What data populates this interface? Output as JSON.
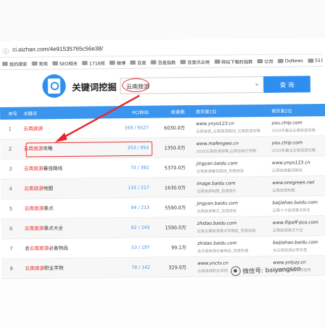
{
  "browser": {
    "url": "ci.aizhan.com/4e91535765c56e38/",
    "bookmarks": [
      "我的搜索",
      "常用",
      "SEO相关",
      "1718视",
      "微博",
      "百度",
      "百度指数",
      "百度风云榜",
      "网站下载的指数",
      "亿邦",
      "DoNews",
      "5118",
      "爱站"
    ]
  },
  "search": {
    "title": "关键词挖掘",
    "value": "云南旅游",
    "button": "查 询"
  },
  "table": {
    "headers": [
      "序号",
      "关键词",
      "PC/移动",
      "收录数",
      "首页第1位",
      "首页第2位"
    ],
    "rows": [
      {
        "idx": "1",
        "kw_hl": "云南旅游",
        "kw_rest": "",
        "pc": "359 / 9327",
        "inc": "6030.0万",
        "s1_domain": "www.ynyo123.cn",
        "s1_desc": "云南旅游_云南旅游路线_云南旅游攻略",
        "s2_domain": "you.ctrip.com",
        "s2_desc": "2020年最全云南旅游攻略"
      },
      {
        "idx": "2",
        "kw_hl": "云南旅游",
        "kw_rest": "攻略",
        "pc": "253 / 954",
        "inc": "1350.0万",
        "s1_domain": "www.mafengwo.cn",
        "s1_desc": "2020云南旅游攻略,云南自由行攻略",
        "s2_domain": "you.ctrip.com",
        "s2_desc": "2020年最全云南旅游攻略"
      },
      {
        "idx": "3",
        "kw_hl": "云南旅游",
        "kw_rest": "最佳路线",
        "pc": "75 / 392",
        "inc": "5370.0万",
        "s1_domain": "jingyan.baidu.com",
        "s1_desc": "云南旅游最佳路线_百度经验",
        "s2_domain": "www.ynyo123.cn",
        "s2_desc": "云南旅游最佳路线"
      },
      {
        "idx": "4",
        "kw_hl": "云南旅游",
        "kw_rest": "地图",
        "pc": "133 / 217",
        "inc": "1630.0万",
        "s1_domain": "image.baidu.com",
        "s1_desc": "云南旅游地图_百度图片",
        "s2_domain": "www.onegreen.net",
        "s2_desc": "云南旅游地图"
      },
      {
        "idx": "5",
        "kw_hl": "云南旅游",
        "kw_rest": "景点",
        "pc": "94 / 213",
        "inc": "5590.0万",
        "s1_domain": "jingyan.baidu.com",
        "s1_desc": "云南旅游景点_百度经验",
        "s2_domain": "baijiahao.baidu.com",
        "s2_desc": "云南十大旅游景点排名"
      },
      {
        "idx": "6",
        "kw_hl": "云南旅游",
        "kw_rest": "景点大全",
        "pc": "62 / 243",
        "inc": "1590.0万",
        "s1_domain": "zhidao.baidu.com",
        "s1_desc": "云南主要旅游景点有哪些_百度知道",
        "s2_domain": "www.flipoff-pco.com",
        "s2_desc": "云南旅游景点大全"
      },
      {
        "idx": "7",
        "kw_pre": "去",
        "kw_hl": "云南旅游",
        "kw_rest": "必备物品",
        "pc": "53 / 197",
        "inc": "99.1万",
        "s1_domain": "zhidao.baidu.com",
        "s1_desc": "去云南旅游必备物品_百度知道",
        "s2_domain": "baijiahao.baidu.com",
        "s2_desc": "去云南旅游必带东西"
      },
      {
        "idx": "8",
        "kw_hl": "云南旅游",
        "kw_rest": "职业学院",
        "pc": "78 / 142",
        "inc": "329.0万",
        "s1_domain": "www.ynctv.cn",
        "s1_desc": "云南旅游职业学院",
        "s2_domain": "www.ynlyzy.cn",
        "s2_desc": "云南旅游职业学院官网"
      }
    ]
  },
  "watermark": "微信号: baiyangseo",
  "colors": {
    "accent": "#2e8ef0",
    "highlight": "#e8262b"
  }
}
